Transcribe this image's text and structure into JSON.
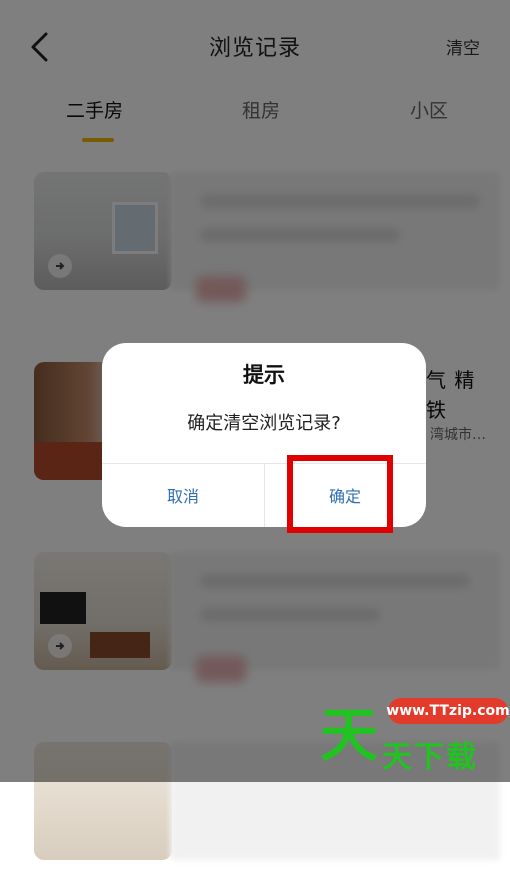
{
  "nav": {
    "title": "浏览记录",
    "clear_label": "清空"
  },
  "tabs": [
    {
      "label": "二手房",
      "active": true
    },
    {
      "label": "租房",
      "active": false
    },
    {
      "label": "小区",
      "active": false
    }
  ],
  "list": {
    "item2": {
      "title_line1": "气 精",
      "title_line2": "铁",
      "subtitle": "湾城市…"
    }
  },
  "dialog": {
    "title": "提示",
    "message": "确定清空浏览记录?",
    "cancel_label": "取消",
    "confirm_label": "确定"
  },
  "watermark": {
    "big": "天",
    "pill": "www.TTzip.com",
    "small": "天下载"
  },
  "colors": {
    "accent_underline": "#f2b600",
    "dialog_button": "#2e6fb3",
    "highlight": "#e00000"
  }
}
